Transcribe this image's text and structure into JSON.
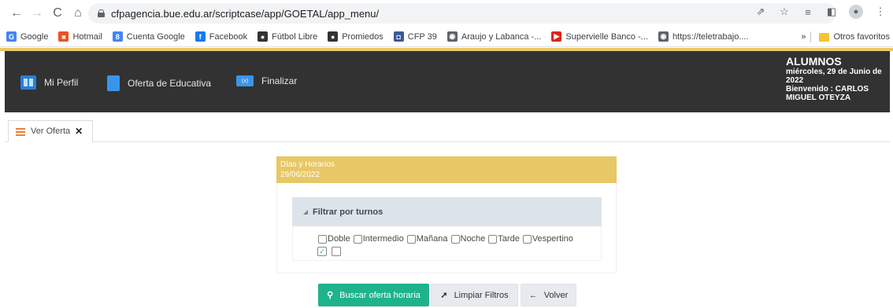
{
  "browser": {
    "url": "cfpagencia.bue.edu.ar/scriptcase/app/GOETAL/app_menu/",
    "bookmarks": [
      {
        "label": "Google",
        "icon": "google-icon",
        "color": "#4285f4"
      },
      {
        "label": "Hotmail",
        "icon": "windows-icon",
        "color": "#f25022"
      },
      {
        "label": "Cuenta Google",
        "icon": "google-account-icon",
        "color": "#4285f4"
      },
      {
        "label": "Facebook",
        "icon": "facebook-icon",
        "color": "#1877f2"
      },
      {
        "label": "Fútbol Libre",
        "icon": "soccer-ball-icon",
        "color": "#333333"
      },
      {
        "label": "Promiedos",
        "icon": "soccer-ball-icon",
        "color": "#333333"
      },
      {
        "label": "CFP 39",
        "icon": "school-icon",
        "color": "#3b5998"
      },
      {
        "label": "Araujo y Labanca -...",
        "icon": "globe-icon",
        "color": "#5f6368"
      },
      {
        "label": "Supervielle Banco -...",
        "icon": "arrow-logo-icon",
        "color": "#e2231a"
      },
      {
        "label": "https://teletrabajo....",
        "icon": "globe-icon",
        "color": "#5f6368"
      }
    ],
    "more": "»",
    "other_favorites": "Otros favoritos"
  },
  "app": {
    "menu": [
      {
        "label": "Mi Perfil",
        "icon": "profile-book-icon"
      },
      {
        "label": "Oferta de Educativa",
        "icon": "document-icon"
      },
      {
        "label": "Finalizar",
        "icon": "exit-icon",
        "icon_text": "(x)"
      }
    ],
    "user": {
      "role": "ALUMNOS",
      "date": "miércoles, 29 de Junio de 2022",
      "welcome": "Bienvenido : CARLOS MIGUEL OTEYZA"
    },
    "accent": "#e8c766",
    "header_bg": "#323232"
  },
  "tab": {
    "label": "Ver Oferta",
    "close": "✕"
  },
  "form": {
    "header_title": "Días y Horarios",
    "header_date": "29/06/2022",
    "filter_title": "Filtrar por turnos",
    "turnos": [
      {
        "label": "Doble",
        "checked": false
      },
      {
        "label": "Intermedio",
        "checked": false
      },
      {
        "label": "Mañana",
        "checked": false
      },
      {
        "label": "Noche",
        "checked": false
      },
      {
        "label": "Tarde",
        "checked": false
      },
      {
        "label": "Vespertino",
        "checked": false
      }
    ],
    "extra_checks": [
      {
        "checked": true
      },
      {
        "checked": false
      }
    ]
  },
  "buttons": {
    "search": "Buscar oferta horaria",
    "clear": "Limpiar Filtros",
    "back": "Volver"
  }
}
